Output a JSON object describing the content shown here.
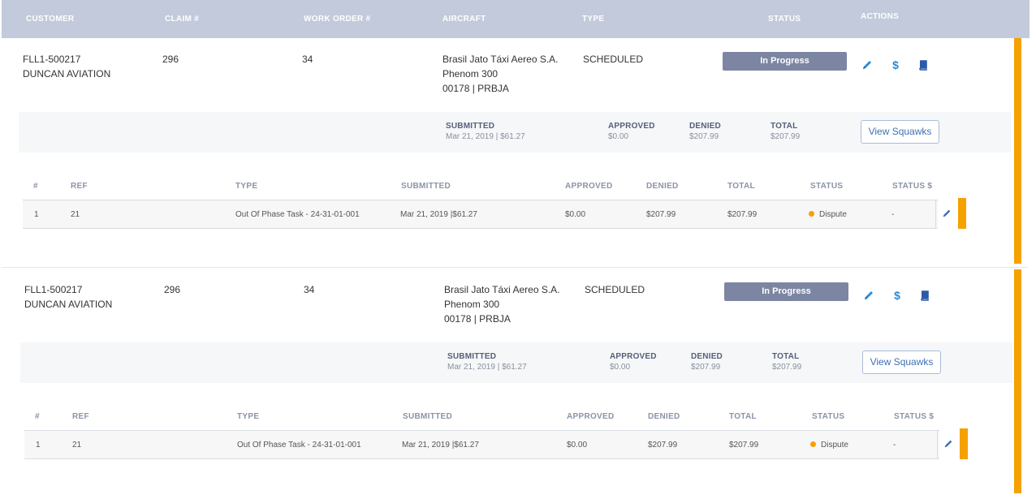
{
  "header": {
    "customer": "CUSTOMER",
    "claim": "CLAIM #",
    "work_order": "WORK ORDER #",
    "aircraft": "AIRCRAFT",
    "type": "TYPE",
    "status": "STATUS",
    "actions": "ACTIONS"
  },
  "colors": {
    "accent_orange": "#f5a100",
    "header_bg": "#c2cadb",
    "badge_bg": "#7c86a3",
    "icon_blue": "#2a8bd6"
  },
  "claims": [
    {
      "customer_id": "FLL1-500217",
      "customer_name": "DUNCAN AVIATION",
      "claim_no": "296",
      "work_order": "34",
      "aircraft_operator": "Brasil Jato Táxi Aereo S.A.",
      "aircraft_model": "Phenom 300",
      "aircraft_reg": "00178 | PRBJA",
      "type": "SCHEDULED",
      "status": "In Progress",
      "actions": [
        "pencil-icon",
        "dollar-icon",
        "book-icon"
      ],
      "summary": {
        "submitted_label": "SUBMITTED",
        "submitted_value": "Mar 21, 2019 | $61.27",
        "approved_label": "APPROVED",
        "approved_value": "$0.00",
        "denied_label": "DENIED",
        "denied_value": "$207.99",
        "total_label": "TOTAL",
        "total_value": "$207.99",
        "button": "View Squawks"
      },
      "squawk_columns": [
        "#",
        "REF",
        "TYPE",
        "SUBMITTED",
        "APPROVED",
        "DENIED",
        "TOTAL",
        "STATUS",
        "STATUS $"
      ],
      "squawks": [
        {
          "num": "1",
          "ref": "21",
          "type": "Out Of Phase Task - 24-31-01-001",
          "submitted": "Mar 21, 2019 |$61.27",
          "approved": "$0.00",
          "denied": "$207.99",
          "total": "$207.99",
          "status": "Dispute",
          "status_dollar": "-"
        }
      ]
    },
    {
      "customer_id": "FLL1-500217",
      "customer_name": "DUNCAN AVIATION",
      "claim_no": "296",
      "work_order": "34",
      "aircraft_operator": "Brasil Jato Táxi Aereo S.A.",
      "aircraft_model": "Phenom 300",
      "aircraft_reg": "00178 | PRBJA",
      "type": "SCHEDULED",
      "status": "In Progress",
      "actions": [
        "pencil-icon",
        "dollar-icon",
        "book-icon"
      ],
      "summary": {
        "submitted_label": "SUBMITTED",
        "submitted_value": "Mar 21, 2019 | $61.27",
        "approved_label": "APPROVED",
        "approved_value": "$0.00",
        "denied_label": "DENIED",
        "denied_value": "$207.99",
        "total_label": "TOTAL",
        "total_value": "$207.99",
        "button": "View Squawks"
      },
      "squawk_columns": [
        "#",
        "REF",
        "TYPE",
        "SUBMITTED",
        "APPROVED",
        "DENIED",
        "TOTAL",
        "STATUS",
        "STATUS $"
      ],
      "squawks": [
        {
          "num": "1",
          "ref": "21",
          "type": "Out Of Phase Task - 24-31-01-001",
          "submitted": "Mar 21, 2019 |$61.27",
          "approved": "$0.00",
          "denied": "$207.99",
          "total": "$207.99",
          "status": "Dispute",
          "status_dollar": "-"
        }
      ]
    }
  ]
}
